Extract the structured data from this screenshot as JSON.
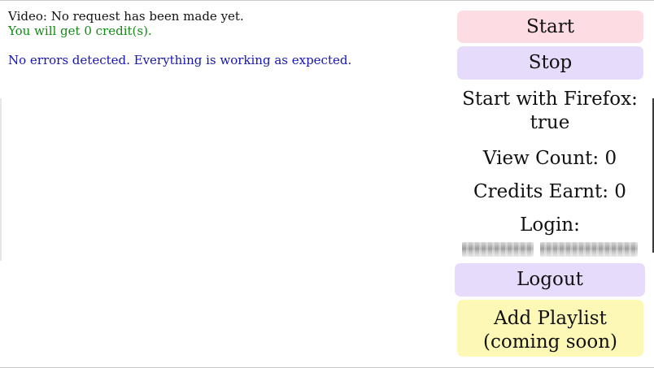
{
  "status": {
    "video_line": "Video: No request has been made yet.",
    "credits_line": "You will get 0 credit(s).",
    "errors_line": "No errors detected. Everything is working as expected."
  },
  "controls": {
    "start_label": "Start",
    "stop_label": "Stop",
    "logout_label": "Logout",
    "playlist_label_line1": "Add Playlist",
    "playlist_label_line2": "(coming soon)"
  },
  "info": {
    "firefox": "Start with Firefox: true",
    "view_count": "View Count: 0",
    "credits_earnt": "Credits Earnt: 0",
    "login_label": "Login:"
  },
  "colors": {
    "start_bg": "#fddde3",
    "stop_bg": "#e6dbfb",
    "logout_bg": "#e6dbfb",
    "playlist_bg": "#fef8b7",
    "credits_text": "#138a13",
    "errors_text": "#1515b5"
  }
}
